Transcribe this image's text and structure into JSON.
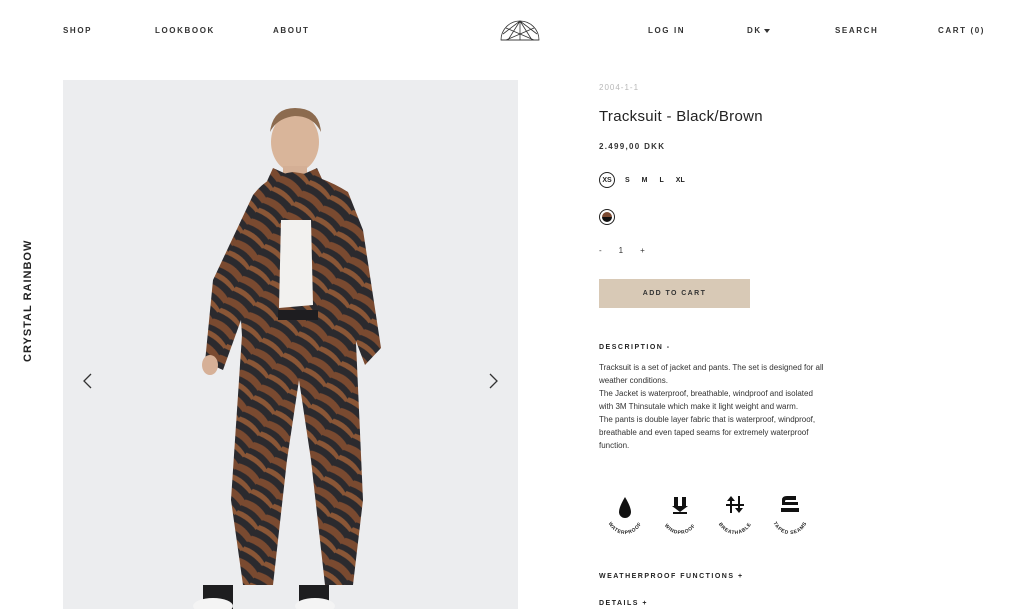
{
  "header": {
    "nav_left": [
      "SHOP",
      "LOOKBOOK",
      "ABOUT"
    ],
    "login": "LOG IN",
    "currency": "DK",
    "search": "SEARCH",
    "cart": "CART (0)"
  },
  "brand": "CRYSTAL RAINBOW",
  "product": {
    "sku": "2004-1-1",
    "title": "Tracksuit - Black/Brown",
    "price": "2.499,00 DKK",
    "sizes": [
      "XS",
      "S",
      "M",
      "L",
      "XL"
    ],
    "selected_size": "XS",
    "quantity": {
      "minus": "-",
      "value": "1",
      "plus": "+"
    },
    "add_to_cart": "ADD TO CART",
    "description_heading": "DESCRIPTION -",
    "description": [
      "Tracksuit is a set of jacket and pants. The set is designed for all weather conditions.",
      "The Jacket is waterproof, breathable, windproof and isolated with 3M Thinsutale which make it light weight and warm.",
      "The pants is double layer fabric that is waterproof, windproof, breathable and even taped seams for extremely waterproof function."
    ],
    "features": [
      {
        "label": "WATERPROOF",
        "icon": "water-drop-icon"
      },
      {
        "label": "WINDPROOF",
        "icon": "wind-arrows-icon"
      },
      {
        "label": "BREATHABLE",
        "icon": "breathable-arrows-icon"
      },
      {
        "label": "TAPED SEAMS",
        "icon": "taped-seams-icon"
      }
    ],
    "weatherproof_heading": "WEATHERPROOF FUNCTIONS +",
    "details_heading": "DETAILS +"
  },
  "colors": {
    "accent_button": "#d8c9b6",
    "text": "#222222",
    "image_bg": "#ecedef"
  }
}
